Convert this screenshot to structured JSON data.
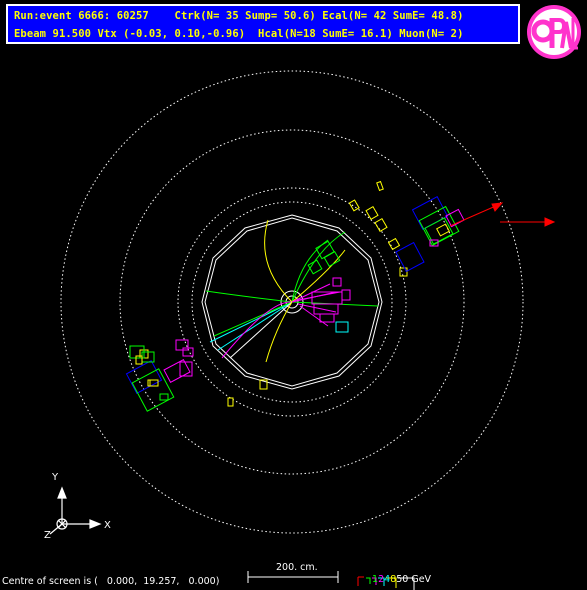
{
  "header": {
    "line1": "Run:event 6666: 60257    Ctrk(N= 35 Sump= 50.6) Ecal(N= 42 SumE= 48.8)",
    "line2": "Ebeam 91.500 Vtx (-0.03, 0.10,-0.96)  Hcal(N=18 SumE= 16.1) Muon(N= 2)"
  },
  "logo": {
    "text": "OPAL"
  },
  "axes": {
    "y": "Y",
    "x": "X",
    "z": "Z"
  },
  "footer": {
    "centre_text": "Centre of screen is (   0.000,  19.257,   0.000)",
    "scale_text": "200. cm.",
    "energy_scale": {
      "labels": [
        "1",
        "2",
        "4",
        "8",
        "50 GeV"
      ],
      "colors": [
        "#00ff00",
        "#ff00ff",
        "#00ffff",
        "#ffff00",
        "#ffffff"
      ]
    }
  },
  "colors": {
    "background": "#000000",
    "header_bg": "#0000ff",
    "header_text": "#ffff00",
    "logo_pink": "#ff33cc",
    "muon_arrow": "#ff0000"
  }
}
